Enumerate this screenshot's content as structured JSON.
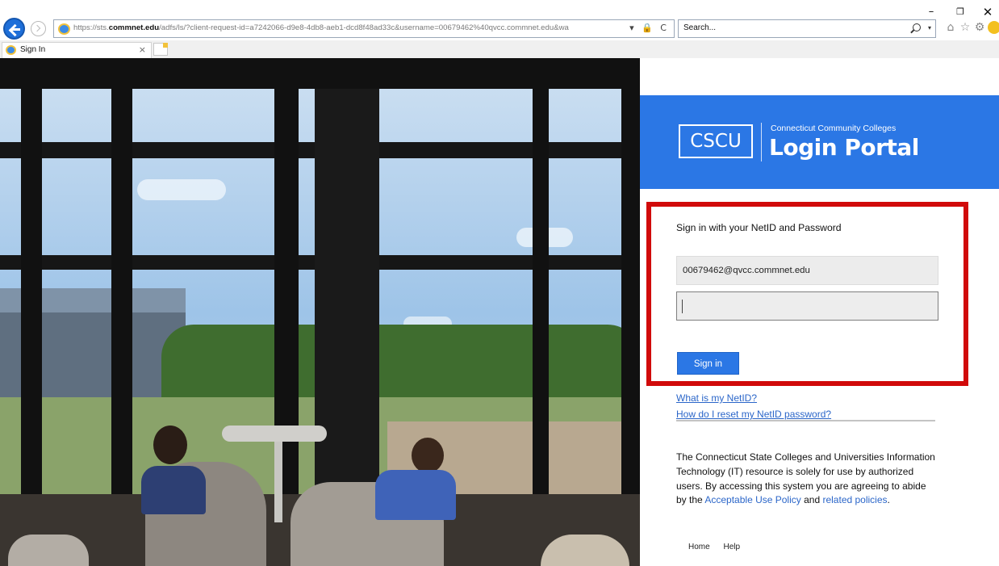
{
  "browser": {
    "url_prefix": "https://sts.",
    "url_domain": "commnet.edu",
    "url_rest": "/adfs/ls/?client-request-id=a7242066-d9e8-4db8-aeb1-dcd8f48ad33c&username=00679462%40qvcc.commnet.edu&wa",
    "address_tools": "▾ 🔒 C",
    "search_placeholder": "Search...",
    "tab_title": "Sign In",
    "tab_close": "×",
    "window_min": "–",
    "window_max": "❐",
    "window_close": "✕",
    "search_caret": "▾",
    "toolbar": {
      "home": "⌂",
      "favorites": "☆",
      "settings": "⚙"
    }
  },
  "brand": {
    "logo": "CSCU",
    "subtitle": "Connecticut Community Colleges",
    "title": "Login Portal",
    "accent_color": "#2b77e5",
    "highlight_color": "#d10a0a"
  },
  "form": {
    "heading": "Sign in with your NetID and Password",
    "username_value": "00679462@qvcc.commnet.edu",
    "password_value": "",
    "sign_in_label": "Sign in"
  },
  "links": {
    "what_is_netid": "What is my NetID?",
    "reset_password": "How do I reset my NetID password?"
  },
  "policy": {
    "text_before": "The Connecticut State Colleges and Universities Information Technology (IT) resource is solely for use by authorized users. By accessing this system you are agreeing to abide by the ",
    "link_acceptable_use": "Acceptable Use Policy",
    "text_middle": " and ",
    "link_related": "related policies",
    "text_end": "."
  },
  "footer": {
    "home": "Home",
    "help": "Help"
  }
}
